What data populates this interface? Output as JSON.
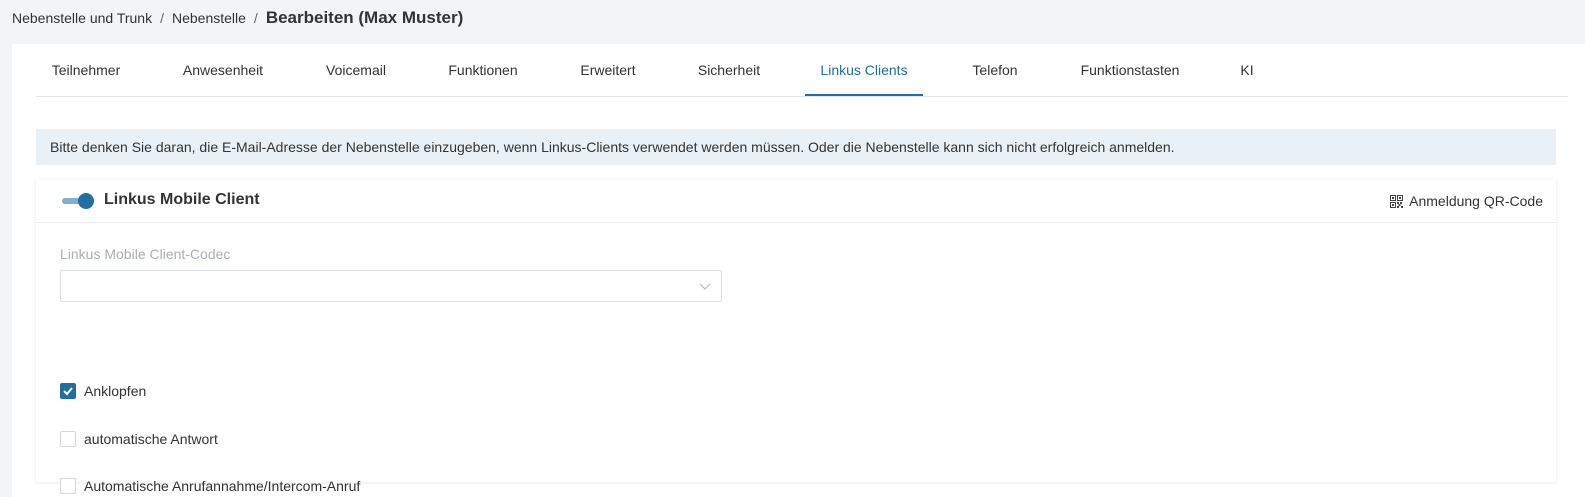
{
  "breadcrumb": {
    "items": [
      "Nebenstelle und Trunk",
      "Nebenstelle"
    ],
    "separator": "/",
    "current": "Bearbeiten (Max Muster)"
  },
  "tabs": [
    {
      "label": "Teilnehmer"
    },
    {
      "label": "Anwesenheit"
    },
    {
      "label": "Voicemail"
    },
    {
      "label": "Funktionen"
    },
    {
      "label": "Erweitert"
    },
    {
      "label": "Sicherheit"
    },
    {
      "label": "Linkus Clients",
      "active": true
    },
    {
      "label": "Telefon"
    },
    {
      "label": "Funktionstasten"
    },
    {
      "label": "KI"
    }
  ],
  "notice": "Bitte denken Sie daran, die E-Mail-Adresse der Nebenstelle einzugeben, wenn Linkus-Clients verwendet werden müssen. Oder die Nebenstelle kann sich nicht erfolgreich anmelden.",
  "mobile_client": {
    "enabled": true,
    "title": "Linkus Mobile Client",
    "qr_link": "Anmeldung QR-Code",
    "qr_icon": "qr-code-icon",
    "codec_label": "Linkus Mobile Client-Codec",
    "codec_value": "",
    "options": [
      {
        "label": "Anklopfen",
        "checked": true
      },
      {
        "label": "automatische Antwort",
        "checked": false
      },
      {
        "label": "Automatische Anrufannahme/Intercom-Anruf",
        "checked": false
      }
    ]
  },
  "colors": {
    "accent": "#1f6fa3",
    "notice_bg": "#e9f1f6",
    "page_bg": "#f3f4f6"
  }
}
